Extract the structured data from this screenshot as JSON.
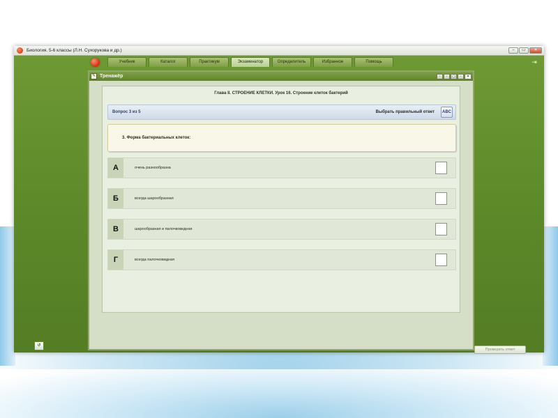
{
  "window": {
    "title": "Биология. 5-6 классы (Л.Н. Сухорукова и др.)",
    "controls": [
      "–",
      "▭",
      "✕"
    ]
  },
  "menu": {
    "tabs": [
      {
        "label": "Учебник",
        "active": false
      },
      {
        "label": "Каталог",
        "active": false
      },
      {
        "label": "Практикум",
        "active": false
      },
      {
        "label": "Экзаменатор",
        "active": true
      },
      {
        "label": "Определитель",
        "active": false
      },
      {
        "label": "Избранное",
        "active": false
      },
      {
        "label": "Помощь",
        "active": false
      }
    ]
  },
  "trainer": {
    "title": "Тренажёр",
    "chapter": "Глава II. СТРОЕНИЕ КЛЕТКИ. Урок 16. Строение клеток бактерий",
    "question_number": "Вопрос 3 из 5",
    "mode": "Выбрать правильный ответ",
    "question_text": "3. Форма бактериальных клеток:",
    "answers": [
      {
        "letter": "А",
        "text": "очень разнообразна",
        "checked": false
      },
      {
        "letter": "Б",
        "text": "всегда шарообразная",
        "checked": false
      },
      {
        "letter": "В",
        "text": "шарообразная и палочковидная",
        "checked": false
      },
      {
        "letter": "Г",
        "text": "всегда палочковидная",
        "checked": false
      }
    ],
    "check_button": "Проверить ответ"
  },
  "colors": {
    "app_green": "#6f9a35",
    "panel_bg": "#d5dfc7",
    "question_bg": "#f9f8e8"
  }
}
